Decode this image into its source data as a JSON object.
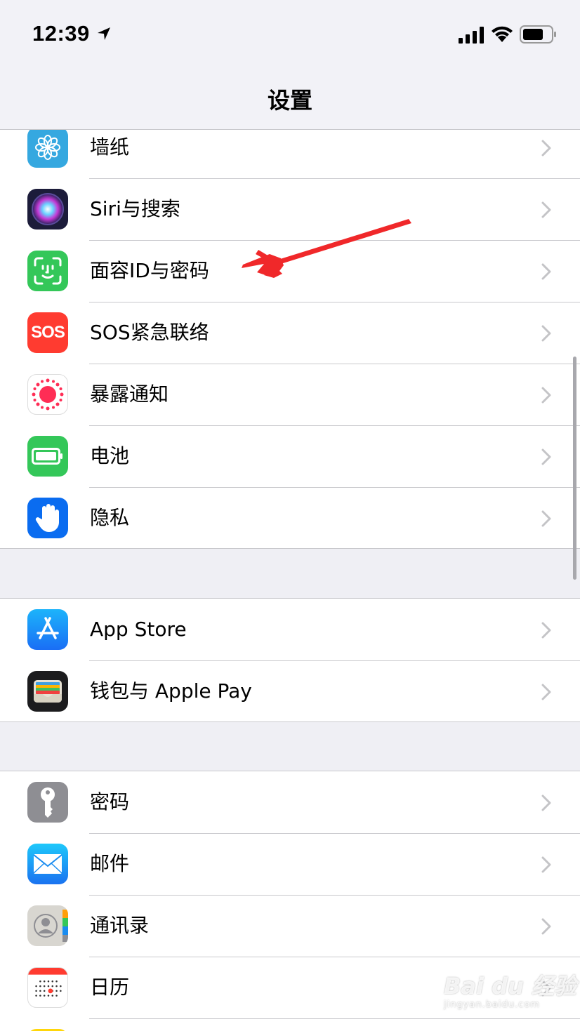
{
  "status_bar": {
    "time": "12:39"
  },
  "nav": {
    "title": "设置"
  },
  "groups": [
    [
      {
        "label": "墙纸",
        "icon": "wallpaper-icon",
        "color": "#35a8e0"
      },
      {
        "label": "Siri与搜索",
        "icon": "siri-icon",
        "color": "#1c1c3a"
      },
      {
        "label": "面容ID与密码",
        "icon": "face-id-icon",
        "color": "#34c759"
      },
      {
        "label": "SOS紧急联络",
        "icon": "sos-icon",
        "color": "#ff3b30"
      },
      {
        "label": "暴露通知",
        "icon": "exposure-notification-icon",
        "color": "#ffffff"
      },
      {
        "label": "电池",
        "icon": "battery-app-icon",
        "color": "#34c759"
      },
      {
        "label": "隐私",
        "icon": "privacy-hand-icon",
        "color": "#0a6cf0"
      }
    ],
    [
      {
        "label": "App Store",
        "icon": "app-store-icon",
        "color": "#1a8cf8"
      },
      {
        "label": "钱包与 Apple Pay",
        "icon": "wallet-icon",
        "color": "#1c1c1e"
      }
    ],
    [
      {
        "label": "密码",
        "icon": "key-icon",
        "color": "#8e8e93"
      },
      {
        "label": "邮件",
        "icon": "mail-icon",
        "color": "#1e90ff"
      },
      {
        "label": "通讯录",
        "icon": "contacts-icon",
        "color": "#d8d6d0"
      },
      {
        "label": "日历",
        "icon": "calendar-icon",
        "color": "#ffffff"
      }
    ]
  ],
  "icon_text": {
    "sos": "SOS"
  },
  "watermark": {
    "logo": "Bai du 经验",
    "url": "jingyan.baidu.com"
  }
}
